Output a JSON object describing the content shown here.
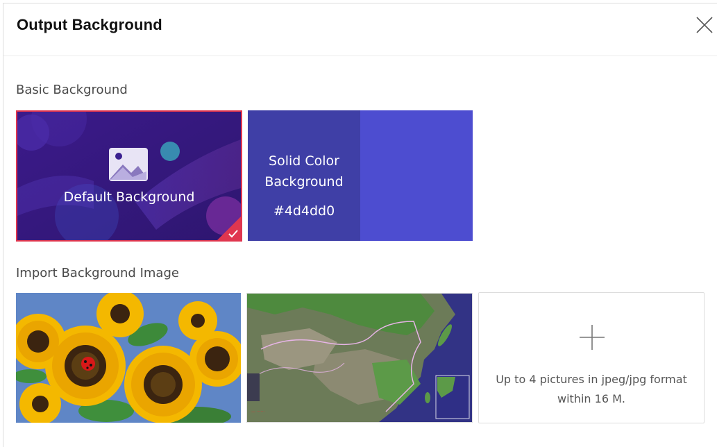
{
  "dialog": {
    "title": "Output Background",
    "close_icon": "close-icon"
  },
  "basic": {
    "section_label": "Basic Background",
    "default_tile": {
      "label": "Default Background",
      "icon": "image-icon",
      "selected": true,
      "check_icon": "checkmark-icon"
    },
    "solid_tile": {
      "label": "Solid Color Background",
      "hex": "#4d4dd0",
      "color": "#4d4dd0"
    }
  },
  "import": {
    "section_label": "Import Background Image",
    "images": [
      "sunflowers-image",
      "satellite-map-image"
    ],
    "upload": {
      "icon": "plus-icon",
      "hint": "Up to 4 pictures in jpeg/jpg format within 16 M."
    }
  },
  "colors": {
    "selected_border": "#e0364f",
    "default_bg": "#3a1f8f",
    "solid_color": "#4d4dd0"
  }
}
